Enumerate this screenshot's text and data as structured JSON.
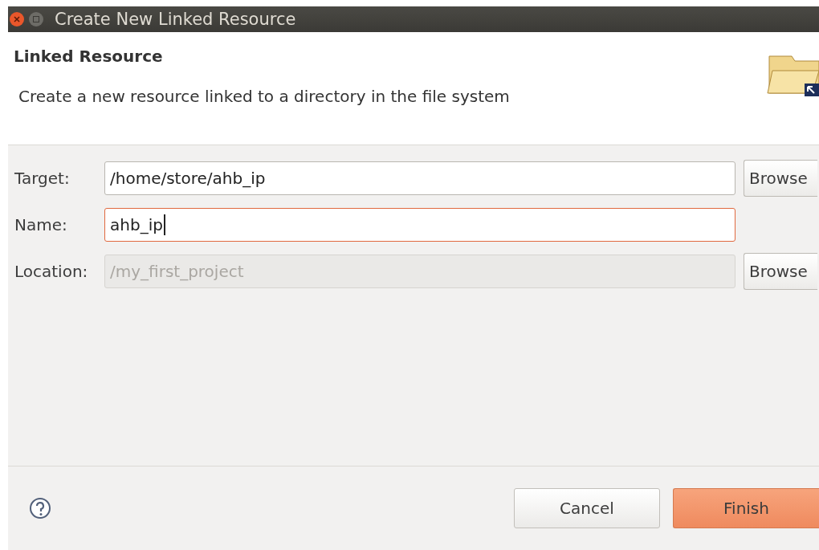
{
  "window": {
    "title": "Create New Linked Resource"
  },
  "header": {
    "title": "Linked Resource",
    "description": "Create a new resource linked to a directory in the file system"
  },
  "fields": [
    {
      "label": "Target:",
      "value": "/home/store/ahb_ip",
      "focused": false,
      "disabled": false,
      "button": "Browse"
    },
    {
      "label": "Name:",
      "value": "ahb_ip",
      "focused": true,
      "disabled": false
    },
    {
      "label": "Location:",
      "value": "/my_first_project",
      "focused": false,
      "disabled": true,
      "button": "Browse"
    }
  ],
  "buttons": [
    {
      "label": "Cancel",
      "default": false
    },
    {
      "label": "Finish",
      "default": true
    }
  ]
}
